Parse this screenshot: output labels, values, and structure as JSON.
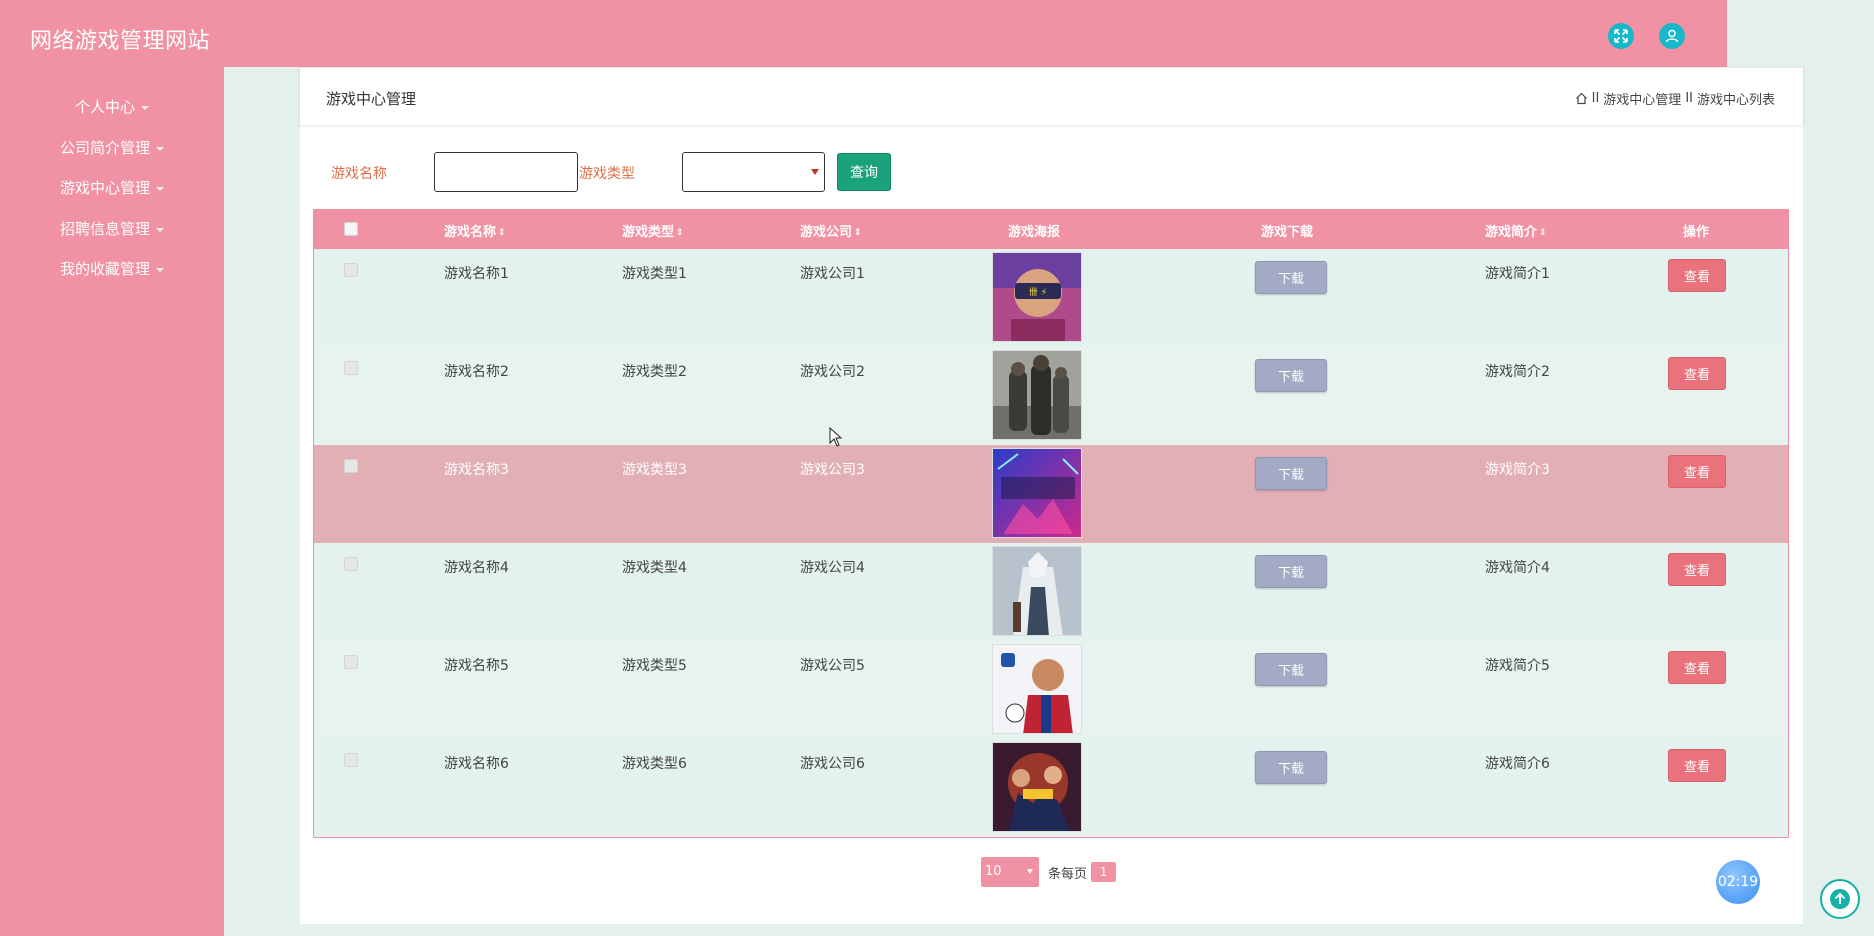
{
  "app": {
    "title": "网络游戏管理网站"
  },
  "top_icons": [
    {
      "icon": "expand-icon"
    },
    {
      "icon": "user-icon"
    }
  ],
  "sidebar": {
    "items": [
      {
        "label": "个人中心"
      },
      {
        "label": "公司简介管理"
      },
      {
        "label": "游戏中心管理"
      },
      {
        "label": "招聘信息管理"
      },
      {
        "label": "我的收藏管理"
      }
    ]
  },
  "page": {
    "title": "游戏中心管理",
    "breadcrumb": {
      "home_icon": "home-icon",
      "sep": "II",
      "level1": "游戏中心管理",
      "level2": "游戏中心列表"
    }
  },
  "search": {
    "name_label": "游戏名称",
    "name_value": "",
    "type_label": "游戏类型",
    "type_value": "",
    "query_label": "查询"
  },
  "table": {
    "headers": {
      "name": "游戏名称",
      "type": "游戏类型",
      "company": "游戏公司",
      "poster": "游戏海报",
      "download": "游戏下载",
      "intro": "游戏简介",
      "action": "操作"
    },
    "download_label": "下载",
    "view_label": "查看",
    "rows": [
      {
        "name": "游戏名称1",
        "type": "游戏类型1",
        "company": "游戏公司1",
        "intro": "游戏简介1"
      },
      {
        "name": "游戏名称2",
        "type": "游戏类型2",
        "company": "游戏公司2",
        "intro": "游戏简介2"
      },
      {
        "name": "游戏名称3",
        "type": "游戏类型3",
        "company": "游戏公司3",
        "intro": "游戏简介3"
      },
      {
        "name": "游戏名称4",
        "type": "游戏类型4",
        "company": "游戏公司4",
        "intro": "游戏简介4"
      },
      {
        "name": "游戏名称5",
        "type": "游戏类型5",
        "company": "游戏公司5",
        "intro": "游戏简介5"
      },
      {
        "name": "游戏名称6",
        "type": "游戏类型6",
        "company": "游戏公司6",
        "intro": "游戏简介6"
      }
    ]
  },
  "pagination": {
    "page_size": "10",
    "per_page_label": "条每页",
    "current_page": "1"
  },
  "timer": "02:19",
  "colors": {
    "primary": "#f092a3",
    "query": "#1aa37a",
    "download": "#a2aac5",
    "view": "#e9727c",
    "row_bg": "#e3f2ee",
    "row_hover": "#e2afb5"
  }
}
